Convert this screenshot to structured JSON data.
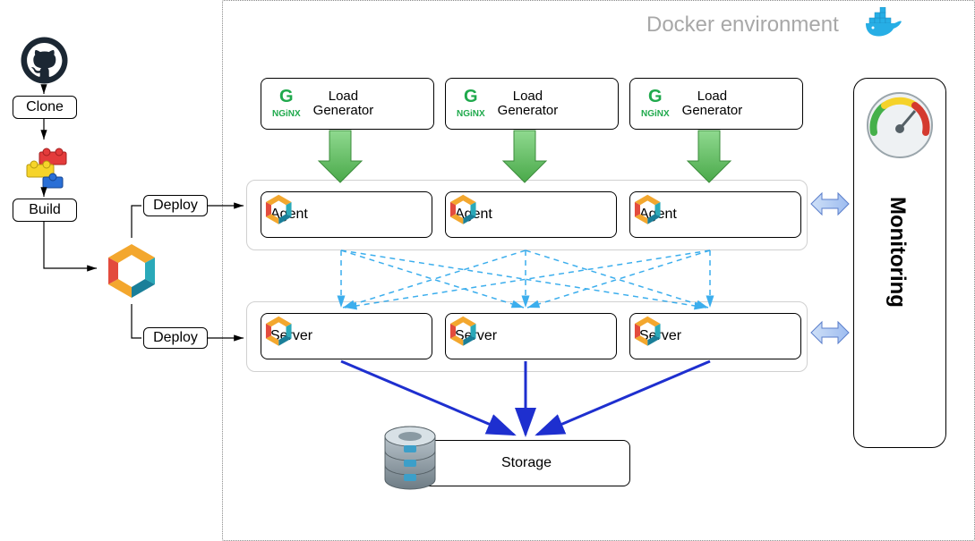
{
  "env": {
    "title": "Docker environment"
  },
  "pipeline": {
    "clone_label": "Clone",
    "build_label": "Build",
    "deploy_agent_label": "Deploy",
    "deploy_server_label": "Deploy"
  },
  "loadGenerators": [
    {
      "line1": "Load",
      "line2": "Generator"
    },
    {
      "line1": "Load",
      "line2": "Generator"
    },
    {
      "line1": "Load",
      "line2": "Generator"
    }
  ],
  "agents": [
    {
      "label": "Agent"
    },
    {
      "label": "Agent"
    },
    {
      "label": "Agent"
    }
  ],
  "servers": [
    {
      "label": "Server"
    },
    {
      "label": "Server"
    },
    {
      "label": "Server"
    }
  ],
  "storage": {
    "label": "Storage"
  },
  "monitoring": {
    "label": "Monitoring"
  },
  "nginx": {
    "label_top": "G",
    "label_bottom": "NGiNX"
  }
}
